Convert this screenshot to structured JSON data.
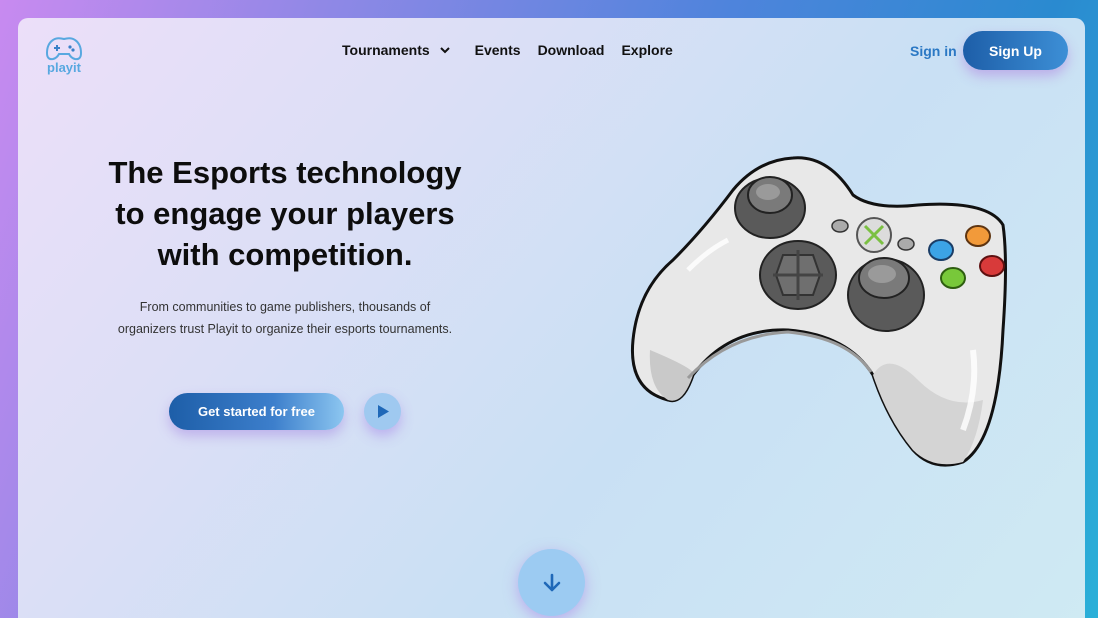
{
  "brand": {
    "name": "playit"
  },
  "nav": {
    "items": [
      {
        "label": "Tournaments"
      },
      {
        "label": "Events"
      },
      {
        "label": "Download"
      },
      {
        "label": "Explore"
      }
    ]
  },
  "auth": {
    "sign_in": "Sign in",
    "sign_up": "Sign Up"
  },
  "hero": {
    "title_lines": [
      "The Esports technology",
      "to engage your players",
      "with competition."
    ],
    "subtitle_lines": [
      "From communities to game publishers, thousands of",
      "organizers trust Playit to organize their esports tournaments."
    ],
    "cta_label": "Get started for free"
  },
  "icons": {
    "logo": "gamepad-icon",
    "dropdown": "chevron-down-icon",
    "play": "play-icon",
    "scroll": "arrow-down-icon",
    "hero_image": "game-controller-illustration"
  },
  "colors": {
    "accent": "#1d5ea8",
    "link": "#2a78c4",
    "logo": "#58a8e0"
  }
}
